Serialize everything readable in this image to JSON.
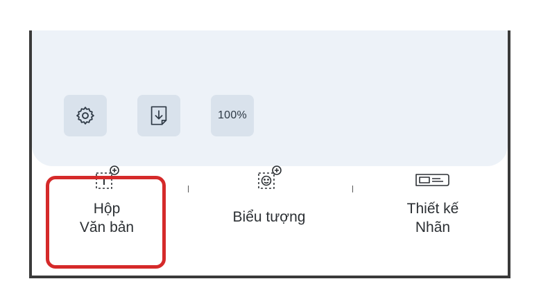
{
  "toolbar": {
    "settings_icon": "gear-icon",
    "save_icon": "download-page-icon",
    "zoom_label": "100%"
  },
  "tabs": [
    {
      "icon": "text-box-add-icon",
      "line1": "Hộp",
      "line2": "Văn bản"
    },
    {
      "icon": "emoji-add-icon",
      "line1": "Biểu tượng"
    },
    {
      "icon": "label-design-icon",
      "line1": "Thiết kế",
      "line2": "Nhãn"
    }
  ],
  "colors": {
    "highlight": "#d52a2a",
    "panel": "#edf2f8",
    "button": "#d9e2ec"
  }
}
